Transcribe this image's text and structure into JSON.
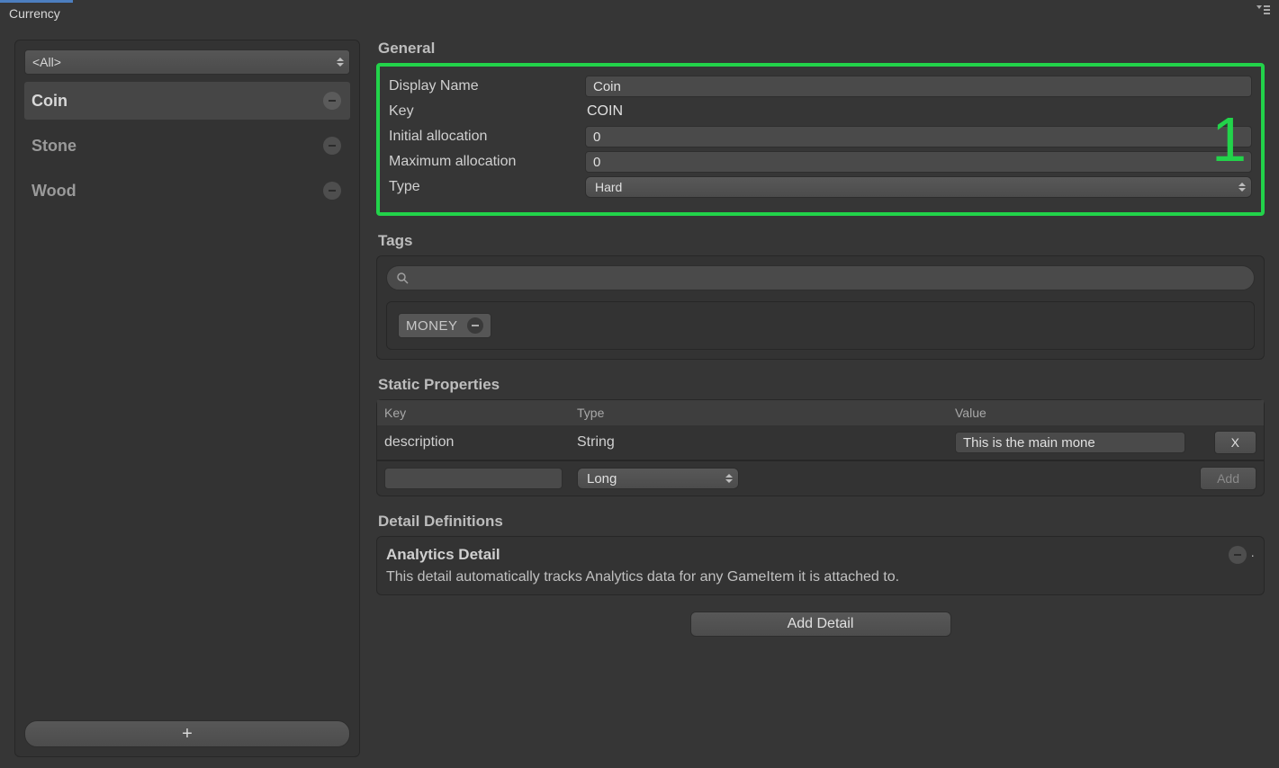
{
  "tab": {
    "title": "Currency"
  },
  "sidebar": {
    "filter_label": "<All>",
    "items": [
      {
        "label": "Coin",
        "selected": true
      },
      {
        "label": "Stone",
        "selected": false
      },
      {
        "label": "Wood",
        "selected": false
      }
    ],
    "add_label": "+"
  },
  "general": {
    "heading": "General",
    "rows": {
      "display_name": {
        "label": "Display Name",
        "value": "Coin"
      },
      "key": {
        "label": "Key",
        "value": "COIN"
      },
      "initial": {
        "label": "Initial allocation",
        "value": "0"
      },
      "max": {
        "label": "Maximum allocation",
        "value": "0"
      },
      "type": {
        "label": "Type",
        "value": "Hard"
      }
    },
    "annotation": "1"
  },
  "tags": {
    "heading": "Tags",
    "search_placeholder": "",
    "chips": [
      {
        "label": "MONEY"
      }
    ]
  },
  "static_props": {
    "heading": "Static Properties",
    "columns": {
      "key": "Key",
      "type": "Type",
      "value": "Value"
    },
    "rows": [
      {
        "key": "description",
        "type": "String",
        "value": "This is the main mone",
        "remove": "X"
      }
    ],
    "new_row": {
      "key": "",
      "type": "Long",
      "add": "Add"
    }
  },
  "details": {
    "heading": "Detail Definitions",
    "panel": {
      "title": "Analytics Detail",
      "desc": "This detail automatically tracks Analytics data for any GameItem it is attached to."
    },
    "add_button": "Add Detail"
  }
}
